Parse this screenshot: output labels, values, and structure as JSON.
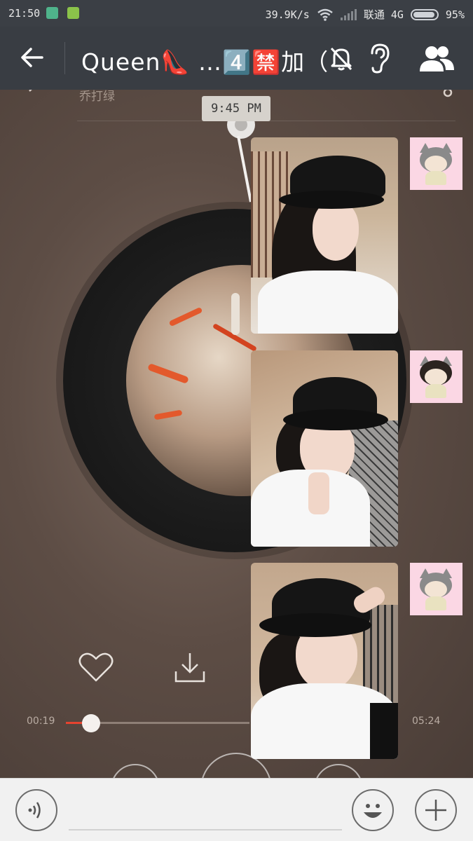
{
  "status_bar": {
    "time": "21:50",
    "network_speed": "39.9K/s",
    "carrier": "联通 4G",
    "battery": "95%",
    "battery_level": 0.95
  },
  "header": {
    "title": "Queen👠 …4️⃣🈲加（",
    "icons": [
      "back-arrow-icon",
      "mute-bell-icon",
      "ear-icon",
      "group-people-icon"
    ]
  },
  "music_player": {
    "song_name": "乔打绿",
    "time_elapsed": "00:19",
    "time_total": "05:24",
    "progress": 0.06
  },
  "chat": {
    "timestamp": "9:45 PM",
    "messages": [
      {
        "type": "image",
        "sender": "self",
        "description_icon": "photo"
      },
      {
        "type": "image",
        "sender": "self",
        "description_icon": "photo"
      },
      {
        "type": "image",
        "sender": "self",
        "description_icon": "photo"
      }
    ]
  },
  "colors": {
    "header_bg": "#393d43",
    "status_bg": "#3b3f45",
    "progress_accent": "#e6432f",
    "avatar_bg": "#fbd7e4"
  }
}
